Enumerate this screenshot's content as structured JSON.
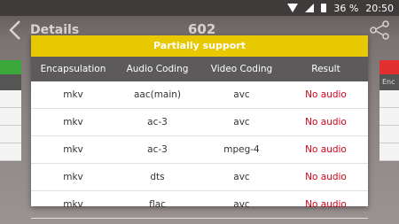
{
  "status_bar": {
    "battery": "36 %",
    "time": "20:50"
  },
  "app_bar": {
    "title": "Details",
    "number": "602"
  },
  "background": {
    "right_header_text": "Enc"
  },
  "colors": {
    "dialog_title_bg": "#e8c800",
    "header_bg": "#5c5a5a",
    "result_text": "#d0021b"
  },
  "dialog": {
    "title": "Partially support",
    "columns": [
      "Encapsulation",
      "Audio Coding",
      "Video Coding",
      "Result"
    ],
    "rows": [
      [
        "mkv",
        "aac(main)",
        "avc",
        "No audio"
      ],
      [
        "mkv",
        "ac-3",
        "avc",
        "No audio"
      ],
      [
        "mkv",
        "ac-3",
        "mpeg-4",
        "No audio"
      ],
      [
        "mkv",
        "dts",
        "avc",
        "No audio"
      ],
      [
        "mkv",
        "flac",
        "avc",
        "No audio"
      ]
    ]
  }
}
